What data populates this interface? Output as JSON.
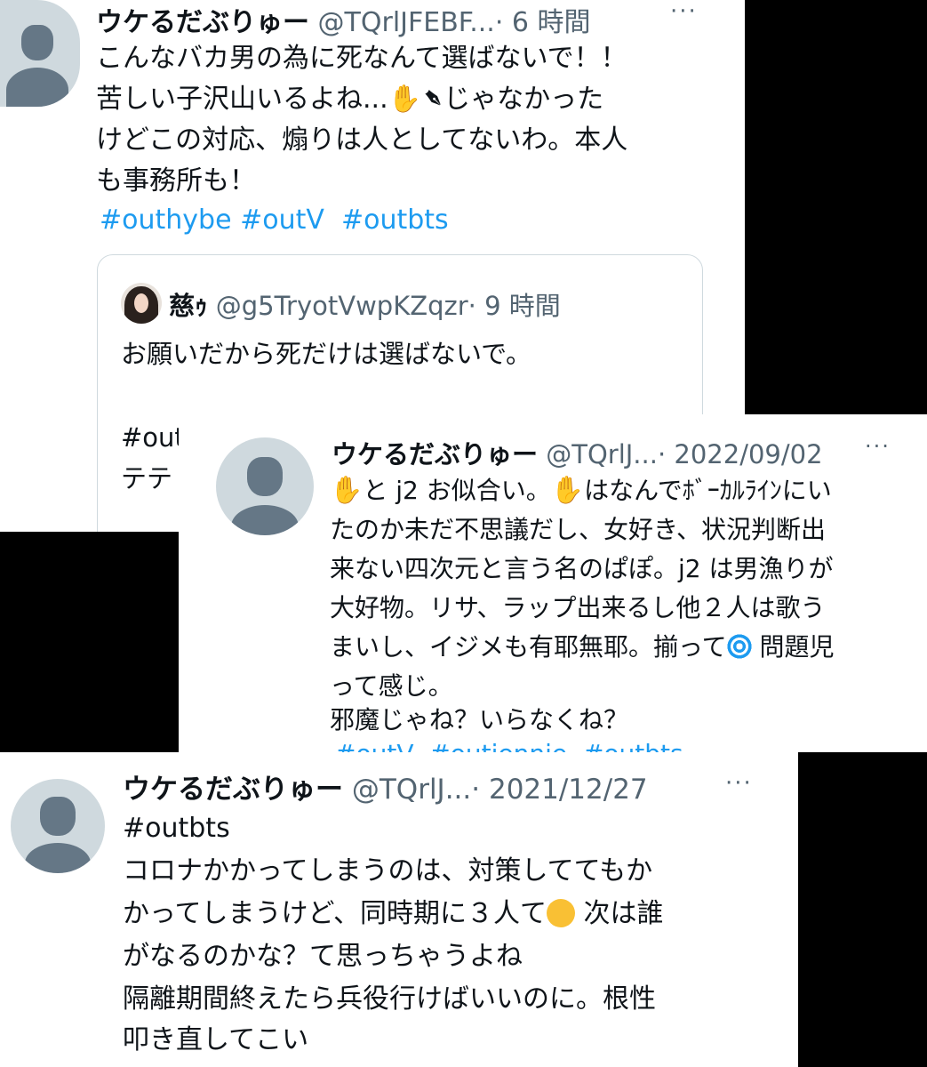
{
  "tweet1": {
    "name": "ウケるだぶりゅー",
    "handle": "@TQrlJFEBF...",
    "time": "· 6 時間",
    "more": "···",
    "lines": [
      "こんなバカ男の為に死なんて選ばないで！！",
      "苦しい子沢山いるよね...",
      "じゃなかった",
      "けどこの対応、煽りは人としてないわ。本人",
      "も事務所も！"
    ],
    "hashtags": [
      "#outhybe",
      "#outV",
      "#outbts"
    ],
    "emoji": [
      "raised-hand",
      "pen"
    ],
    "quote": {
      "name": "慈ｩ",
      "handle": "@g5TryotVwpKZqzr",
      "time": "· 9 時間",
      "line1": "お願いだから死だけは選ばないで。",
      "line2": "#out",
      "line3": "テテ"
    }
  },
  "tweet2": {
    "name": "ウケるだぶりゅー",
    "handle": "@TQrlJ...",
    "time": "· 2022/09/02",
    "more": "···",
    "lines": [
      "と j2 お似合い。",
      "はなんでﾎﾞｰｶﾙﾗｲﾝにい",
      "たのか未だ不思議だし、女好き、状況判断出",
      "来ない四次元と言う名のぱぽ。j2 は男漁りが",
      "大好物。リサ、ラップ出来るし他２人は歌う",
      "まいし、イジメも有耶無耶。揃って",
      "問題児",
      "って感じ。",
      "邪魔じゃね？いらなくね？"
    ],
    "hashtags": [
      "#outV",
      "#outjennie",
      "#outbts"
    ],
    "emoji": [
      "raised-hand",
      "raised-hand",
      "cyclone"
    ]
  },
  "tweet3": {
    "name": "ウケるだぶりゅー",
    "handle": "@TQrlJ...",
    "time": "· 2021/12/27",
    "more": "···",
    "hashtag": "#outbts",
    "lines": [
      "コロナかかってしまうのは、対策しててもか",
      "かってしまうけど、同時期に３人て",
      "次は誰",
      "がなるのかな？て思っちゃうよね",
      "隔離期間終えたら兵役行けばいいのに。根性",
      "叩き直してこい"
    ],
    "emoji": [
      "rolling-on-floor-laughing"
    ]
  }
}
